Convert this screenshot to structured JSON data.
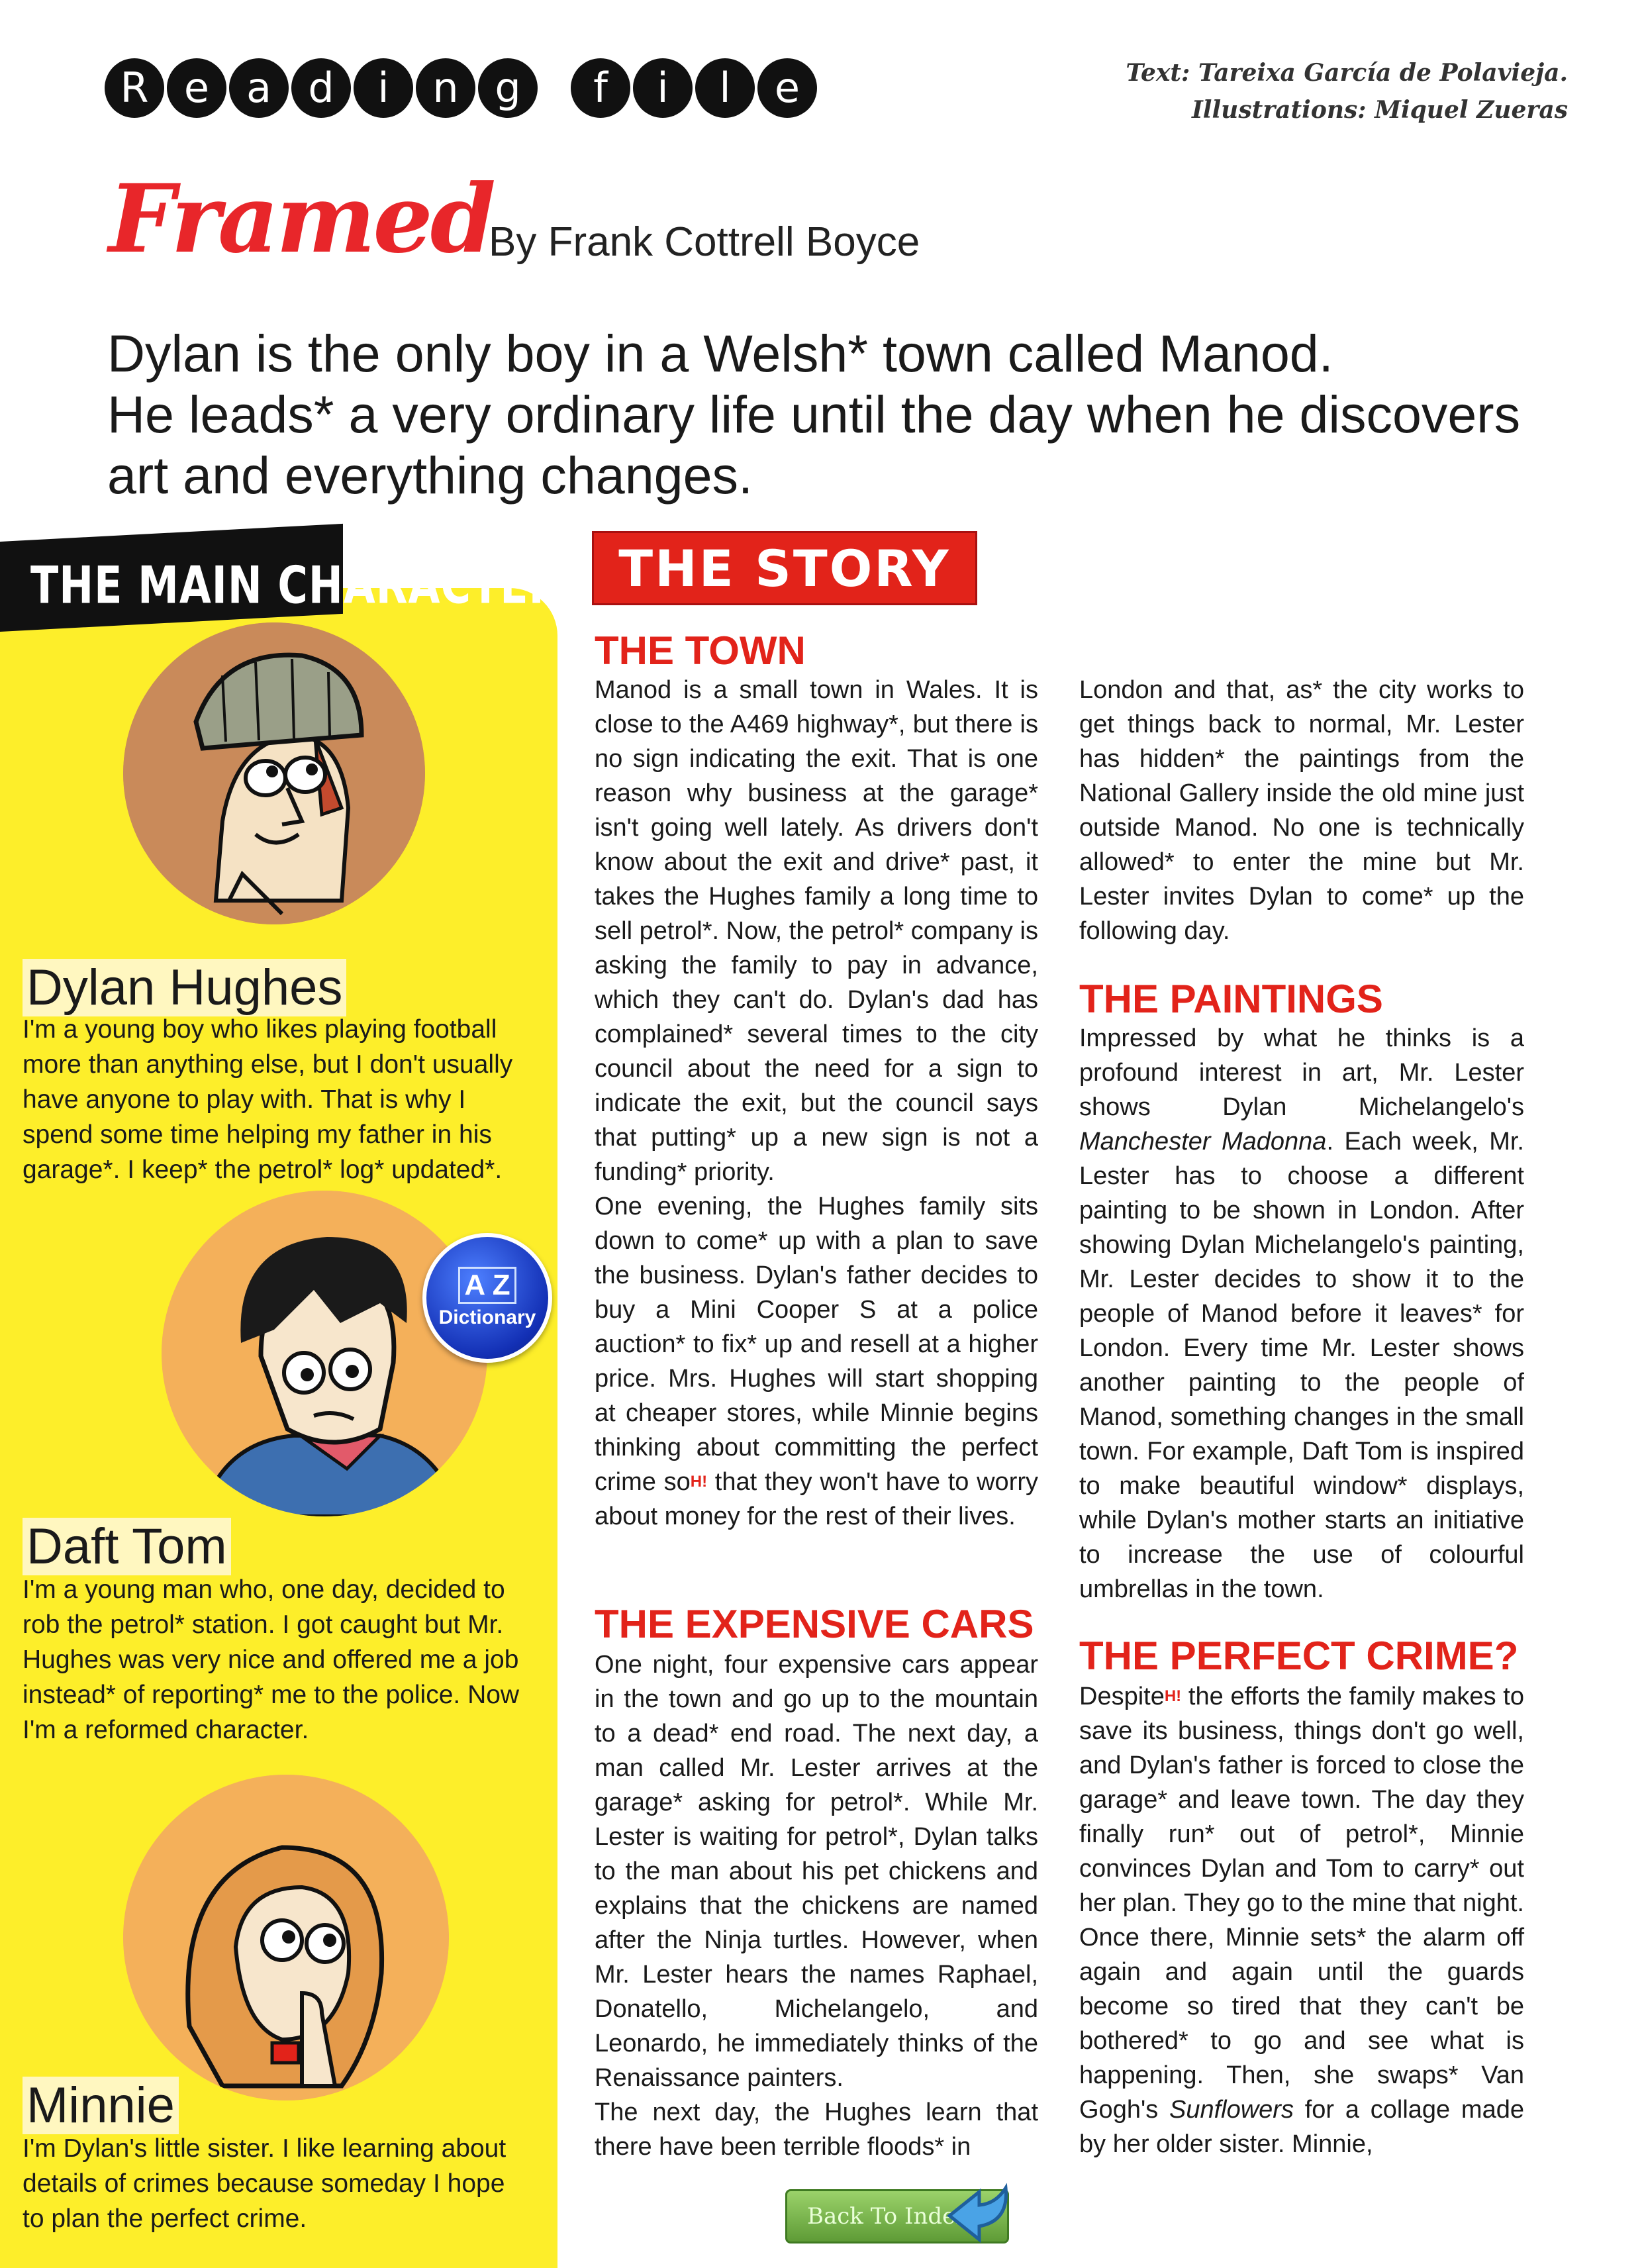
{
  "header": {
    "section_letters": [
      "R",
      "e",
      "a",
      "d",
      "i",
      "n",
      "g",
      " ",
      "f",
      "i",
      "l",
      "e"
    ],
    "credit_text": "Text: Tareixa García de Polavieja.",
    "credit_illustrations": "Illustrations: Miquel Zueras",
    "title": "Framed",
    "author": "By Frank Cottrell Boyce"
  },
  "intro": [
    "Dylan is the only boy in a Welsh* town called Manod.",
    "He leads* a very ordinary life until the day when he discovers",
    "art and everything changes."
  ],
  "characters": {
    "banner": "THE MAIN CHARACTERS",
    "dictionary_badge": "Dictionary",
    "dictionary_book": "A Z",
    "list": [
      {
        "name": "Dylan Hughes",
        "text": "I'm a young boy who likes playing football more than anything else, but I don't usually have anyone to play with. That is why I spend some time helping my father in his garage*. I keep* the petrol* log* updated*."
      },
      {
        "name": "Daft Tom",
        "text": "I'm a young man who, one day, decided to rob the petrol* station. I got caught but Mr. Hughes was very nice and offered me a job instead* of reporting* me to the police. Now I'm a reformed character."
      },
      {
        "name": "Minnie",
        "text": "I'm Dylan's little sister. I like learning about details of crimes because someday I hope to plan the perfect crime."
      }
    ]
  },
  "story": {
    "heading": "THE STORY",
    "hint_mark": "H!",
    "sections": {
      "town": {
        "title": "THE TOWN",
        "p1": "Manod is a small town in Wales. It is close to the A469 highway*, but there is no sign indicating the exit. That is one reason why business at the garage* isn't going well lately. As drivers don't know about the exit and drive* past, it takes the Hughes family a long time to sell petrol*. Now, the petrol* company is asking the family to pay in advance, which they can't do. Dylan's dad has complained* several times to the city council about the need for a sign to indicate the exit, but the council says that putting* up a new sign is not a funding* priority.",
        "p2_a": "One evening, the Hughes family sits down to come* up with a plan to save the business. Dylan's father decides to buy a Mini Cooper S at a police auction* to fix* up and resell at a higher price. Mrs. Hughes will start shopping at cheaper stores, while Minnie begins thinking about committing the perfect crime so",
        "p2_b": " that they won't have to worry about money for the rest of their lives."
      },
      "cars": {
        "title": "THE EXPENSIVE CARS",
        "p1": "One night, four expensive cars appear in the town and go up to the mountain to a dead* end road. The next day, a man called Mr. Lester arrives at the garage* asking for petrol*. While Mr. Lester is waiting for petrol*, Dylan talks to the man about his pet chickens and explains that the chickens are named after the Ninja turtles. However, when Mr. Lester hears the names Raphael, Donatello, Michelangelo, and Leonardo, he immediately thinks of the Renaissance painters.",
        "p2": "The next day, the Hughes learn that there have been terrible floods* in"
      },
      "col2_start": "London and that, as* the city works to get things back to normal, Mr. Lester has hidden* the paintings from the National Gallery inside the old mine just outside Manod. No one is technically allowed* to enter the mine but Mr. Lester invites Dylan to come* up the following day.",
      "paintings": {
        "title": "THE PAINTINGS",
        "p1_a": "Impressed by what he thinks is a profound interest in art, Mr. Lester shows Dylan Michelangelo's ",
        "p1_em": "Manchester Madonna",
        "p1_b": ". Each week, Mr. Lester has to choose a different painting to be shown in London. After showing Dylan Michelangelo's painting, Mr. Lester decides to show it to the people of Manod before it leaves* for London. Every time Mr. Lester shows another painting to the people of Manod, something changes in the small town. For example, Daft Tom is inspired to make beautiful window* displays, while Dylan's mother starts an initiative to increase the use of colourful umbrellas in the town."
      },
      "crime": {
        "title": "THE PERFECT CRIME?",
        "p1_a": "Despite",
        "p1_b": " the efforts the family makes to save its business, things don't go well, and Dylan's father is forced to close the garage* and leave town. The day they finally run* out of petrol*, Minnie convinces Dylan and Tom to carry* out her plan. They go to the mine that night. Once there, Minnie sets* the alarm off again and again until the guards become so tired that they can't be bothered* to go and see what is happening. Then, she swaps* Van Gogh's ",
        "p1_em": "Sunflowers",
        "p1_c": " for a collage made by her older sister. Minnie,"
      }
    }
  },
  "nav": {
    "back_label": "Back To Index"
  },
  "colors": {
    "accent_red": "#e2231a",
    "panel_yellow": "#fdee2a"
  }
}
